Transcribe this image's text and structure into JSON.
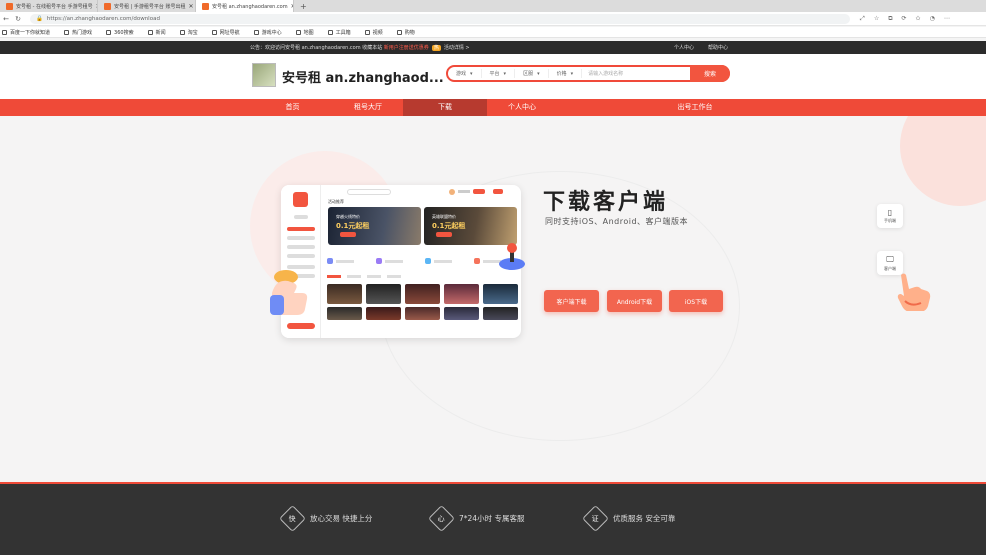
{
  "browser": {
    "tabs": [
      {
        "label": "安号租 - 在线租号平台 手游号租号"
      },
      {
        "label": "安号租 | 手游租号平台 账号出租"
      },
      {
        "label": "安号租 an.zhanghaodaren.com"
      }
    ],
    "new_tab_label": "+",
    "url": "https://an.zhanghaodaren.com/download",
    "bookmarks": [
      "百度一下你就知道",
      "热门游戏",
      "360搜索",
      "新闻",
      "淘宝",
      "网址导航",
      "游戏中心",
      "地图",
      "工具箱",
      "视频",
      "购物"
    ]
  },
  "notice": {
    "text": "公告：欢迎访问安号租 an.zhanghaodaren.com 收藏本站",
    "highlight": "新用户注册送优惠券",
    "hot_badge": "热",
    "tail": "活动详情 >",
    "links": [
      "个人中心",
      "帮助中心"
    ]
  },
  "header": {
    "site_name": "安号租 an.zhanghaod...",
    "search": {
      "selects": [
        "游戏",
        "平台",
        "区服",
        "价格"
      ],
      "placeholder": "请输入游戏名称",
      "button": "搜索"
    }
  },
  "nav": {
    "items": [
      "首页",
      "租号大厅",
      "下载",
      "个人中心",
      "出号工作台"
    ],
    "active_index": 2
  },
  "download": {
    "title": "下载客户端",
    "subtitle": "同时支持iOS、Android、客户端版本",
    "buttons": [
      "客户端下载",
      "Android下载",
      "iOS下载"
    ]
  },
  "mockup": {
    "section_title": "活动推荐",
    "banner1_title": "穿越火线特价",
    "banner1_price": "0.1元起租",
    "banner2_title": "英雄联盟特价",
    "banner2_price": "0.1元起租"
  },
  "floating": [
    {
      "icon": "phone-icon",
      "label": "手机端"
    },
    {
      "icon": "monitor-icon",
      "label": "客户端"
    }
  ],
  "footer": {
    "features": [
      {
        "badge": "快",
        "text": "放心交易 快捷上分"
      },
      {
        "badge": "心",
        "text": "7*24小时 专属客服"
      },
      {
        "badge": "证",
        "text": "优质服务 安全可靠"
      }
    ]
  },
  "colors": {
    "brand_red": "#ef4a38",
    "dark": "#333333",
    "button": "#f2654f"
  }
}
